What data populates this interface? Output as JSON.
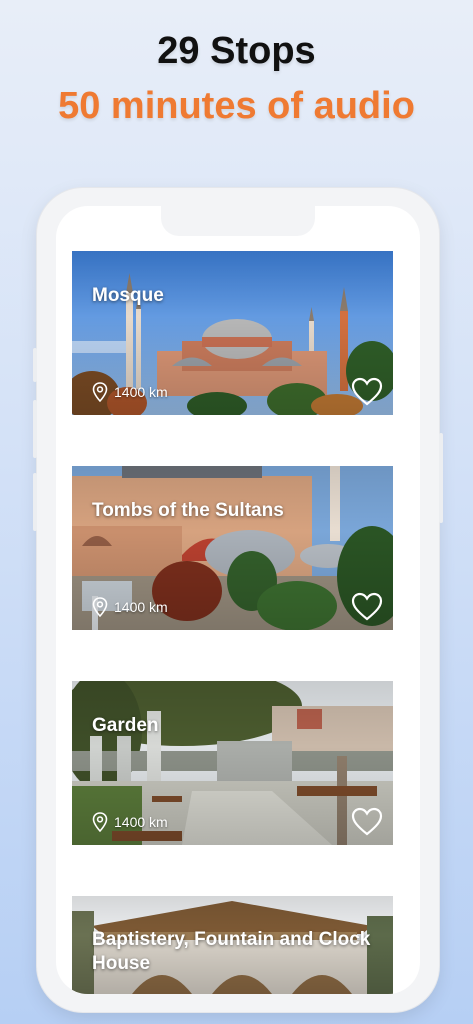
{
  "headline": {
    "stops": "29 Stops",
    "audio": "50 minutes of audio"
  },
  "colors": {
    "accent": "#ef7a32",
    "text_dark": "#111111"
  },
  "stops": [
    {
      "title": "Mosque",
      "distance": "1400 km",
      "favorite_icon": "heart-outline-icon",
      "location_icon": "location-pin-icon"
    },
    {
      "title": "Tombs of the Sultans",
      "distance": "1400 km",
      "favorite_icon": "heart-outline-icon",
      "location_icon": "location-pin-icon"
    },
    {
      "title": "Garden",
      "distance": "1400 km",
      "favorite_icon": "heart-outline-icon",
      "location_icon": "location-pin-icon"
    },
    {
      "title": "Baptistery, Fountain and Clock House"
    }
  ]
}
